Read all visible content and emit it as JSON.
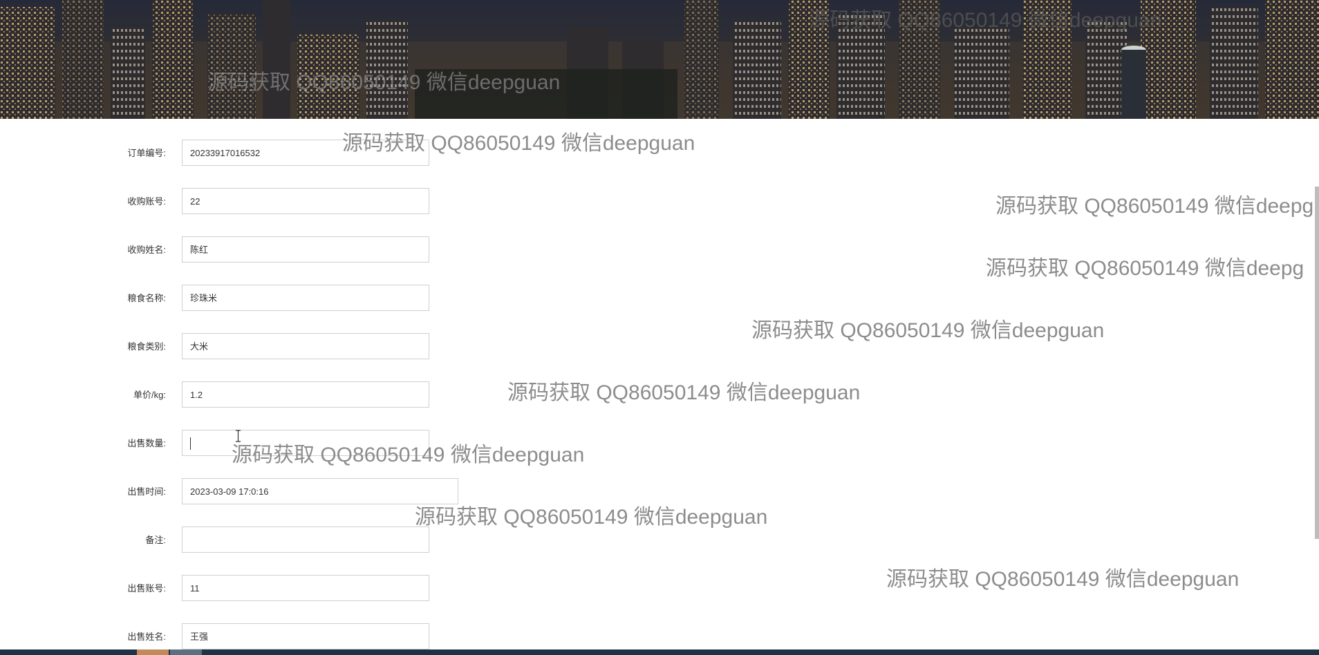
{
  "watermark_text": "源码获取 QQ86050149 微信deepguan",
  "banner": {
    "overlay_text_1": "源码获取 QQ86050149 微信deepguan",
    "overlay_text_2": "源码获取 QQ86050149 微信deepguan"
  },
  "form": {
    "fields": [
      {
        "label": "订单编号:",
        "value": "20233917016532"
      },
      {
        "label": "收购账号:",
        "value": "22"
      },
      {
        "label": "收购姓名:",
        "value": "陈红"
      },
      {
        "label": "粮食名称:",
        "value": "珍珠米"
      },
      {
        "label": "粮食类别:",
        "value": "大米"
      },
      {
        "label": "单价/kg:",
        "value": "1.2"
      },
      {
        "label": "出售数量:",
        "value": ""
      },
      {
        "label": "出售时间:",
        "value": "2023-03-09 17:0:16"
      },
      {
        "label": "备注:",
        "value": ""
      },
      {
        "label": "出售账号:",
        "value": "11"
      },
      {
        "label": "出售姓名:",
        "value": "王强"
      }
    ]
  },
  "watermarks": [
    "源码获取 QQ86050149 微信deepguan",
    "源码获取 QQ86050149 微信deepg",
    "源码获取 QQ86050149 微信deepg",
    "源码获取 QQ86050149 微信deepguan",
    "源码获取 QQ86050149 微信deepguan",
    "源码获取 QQ86050149 微信deepguan",
    "源码获取 QQ86050149 微信deepguan",
    "源码获取 QQ86050149 微信deepguan"
  ],
  "colors": {
    "taskbar": "#1e3346",
    "input_border": "#cfcfcf",
    "watermark": "#787878"
  }
}
